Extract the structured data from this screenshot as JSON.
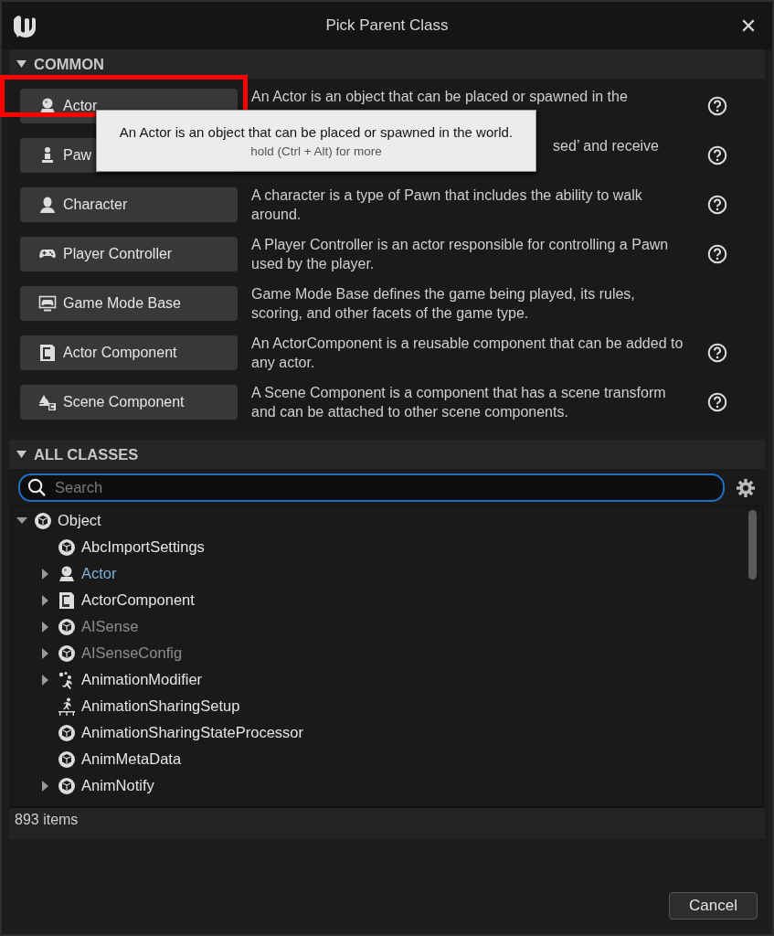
{
  "window": {
    "title": "Pick Parent Class",
    "close": "✕"
  },
  "common": {
    "header": "COMMON",
    "expanded": true,
    "items": [
      {
        "kind": "actor",
        "label": "Actor",
        "description": "An Actor is an object that can be placed or spawned in the",
        "help": true,
        "highlighted": true,
        "covered": false
      },
      {
        "kind": "pawn",
        "label": "Paw",
        "description": "sed’ and receive",
        "help": true,
        "highlighted": false,
        "covered": true
      },
      {
        "kind": "character",
        "label": "Character",
        "description": "A character is a type of Pawn that includes the ability to walk around.",
        "help": true,
        "highlighted": false,
        "covered": false
      },
      {
        "kind": "controller",
        "label": "Player Controller",
        "description": "A Player Controller is an actor responsible for controlling a Pawn used by the player.",
        "help": true,
        "highlighted": false,
        "covered": false
      },
      {
        "kind": "gamemode",
        "label": "Game Mode Base",
        "description": "Game Mode Base defines the game being played, its rules, scoring, and other facets of the game type.",
        "help": false,
        "highlighted": false,
        "covered": false
      },
      {
        "kind": "component",
        "label": "Actor Component",
        "description": "An ActorComponent is a reusable component that can be added to any actor.",
        "help": true,
        "highlighted": false,
        "covered": false
      },
      {
        "kind": "scene",
        "label": "Scene Component",
        "description": "A Scene Component is a component that has a scene transform and can be attached to other scene components.",
        "help": true,
        "highlighted": false,
        "covered": false
      }
    ]
  },
  "tooltip": {
    "text": "An Actor is an object that can be placed or spawned in the world.",
    "hint": "hold (Ctrl + Alt) for more"
  },
  "all_classes": {
    "header": "ALL CLASSES",
    "expanded": true,
    "search": {
      "placeholder": "Search"
    },
    "tree": [
      {
        "label": "Object",
        "kind": "cube",
        "has_children": true,
        "expanded": true,
        "selected": false,
        "dimmed": false,
        "children": [
          {
            "label": "AbcImportSettings",
            "kind": "cube",
            "has_children": false,
            "selected": false,
            "dimmed": false
          },
          {
            "label": "Actor",
            "kind": "actor",
            "has_children": true,
            "expanded": false,
            "selected": true,
            "dimmed": false
          },
          {
            "label": "ActorComponent",
            "kind": "component",
            "has_children": true,
            "expanded": false,
            "selected": false,
            "dimmed": false
          },
          {
            "label": "AISense",
            "kind": "cube",
            "has_children": true,
            "expanded": false,
            "selected": false,
            "dimmed": true
          },
          {
            "label": "AISenseConfig",
            "kind": "cube",
            "has_children": true,
            "expanded": false,
            "selected": false,
            "dimmed": true
          },
          {
            "label": "AnimationModifier",
            "kind": "modifier",
            "has_children": true,
            "expanded": false,
            "selected": false,
            "dimmed": false
          },
          {
            "label": "AnimationSharingSetup",
            "kind": "sharing",
            "has_children": false,
            "selected": false,
            "dimmed": false
          },
          {
            "label": "AnimationSharingStateProcessor",
            "kind": "cube",
            "has_children": false,
            "selected": false,
            "dimmed": false
          },
          {
            "label": "AnimMetaData",
            "kind": "cube",
            "has_children": false,
            "selected": false,
            "dimmed": false
          },
          {
            "label": "AnimNotify",
            "kind": "cube",
            "has_children": true,
            "expanded": false,
            "selected": false,
            "dimmed": false
          }
        ]
      }
    ],
    "status": "893 items"
  },
  "buttons": [
    "Cancel"
  ]
}
